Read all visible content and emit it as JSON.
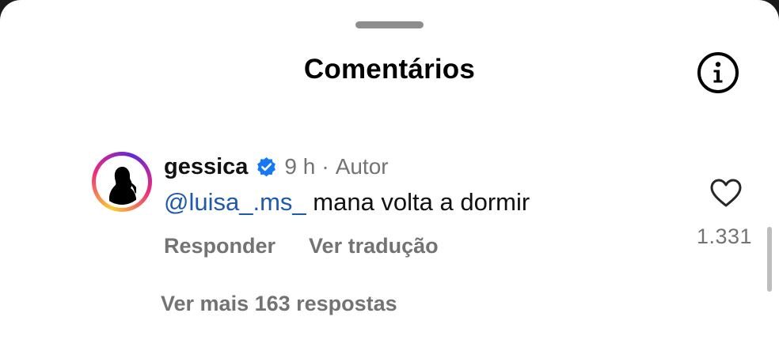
{
  "header": {
    "title": "Comentários",
    "info_icon": "info-circle-icon"
  },
  "comment": {
    "username": "gessica",
    "verified_icon": "verified-badge-icon",
    "time": "9 h",
    "separator": "·",
    "author_label": "Autor",
    "mention": "@luisa_.ms_",
    "text": " mana volta a dormir",
    "reply_label": "Responder",
    "translate_label": "Ver tradução",
    "like_icon": "heart-outline-icon",
    "like_count": "1.331",
    "more_replies_label": "Ver mais 163 respostas"
  },
  "colors": {
    "verified_blue": "#1877f2",
    "mention_blue": "#1e5aa8",
    "secondary_text": "#737373"
  }
}
